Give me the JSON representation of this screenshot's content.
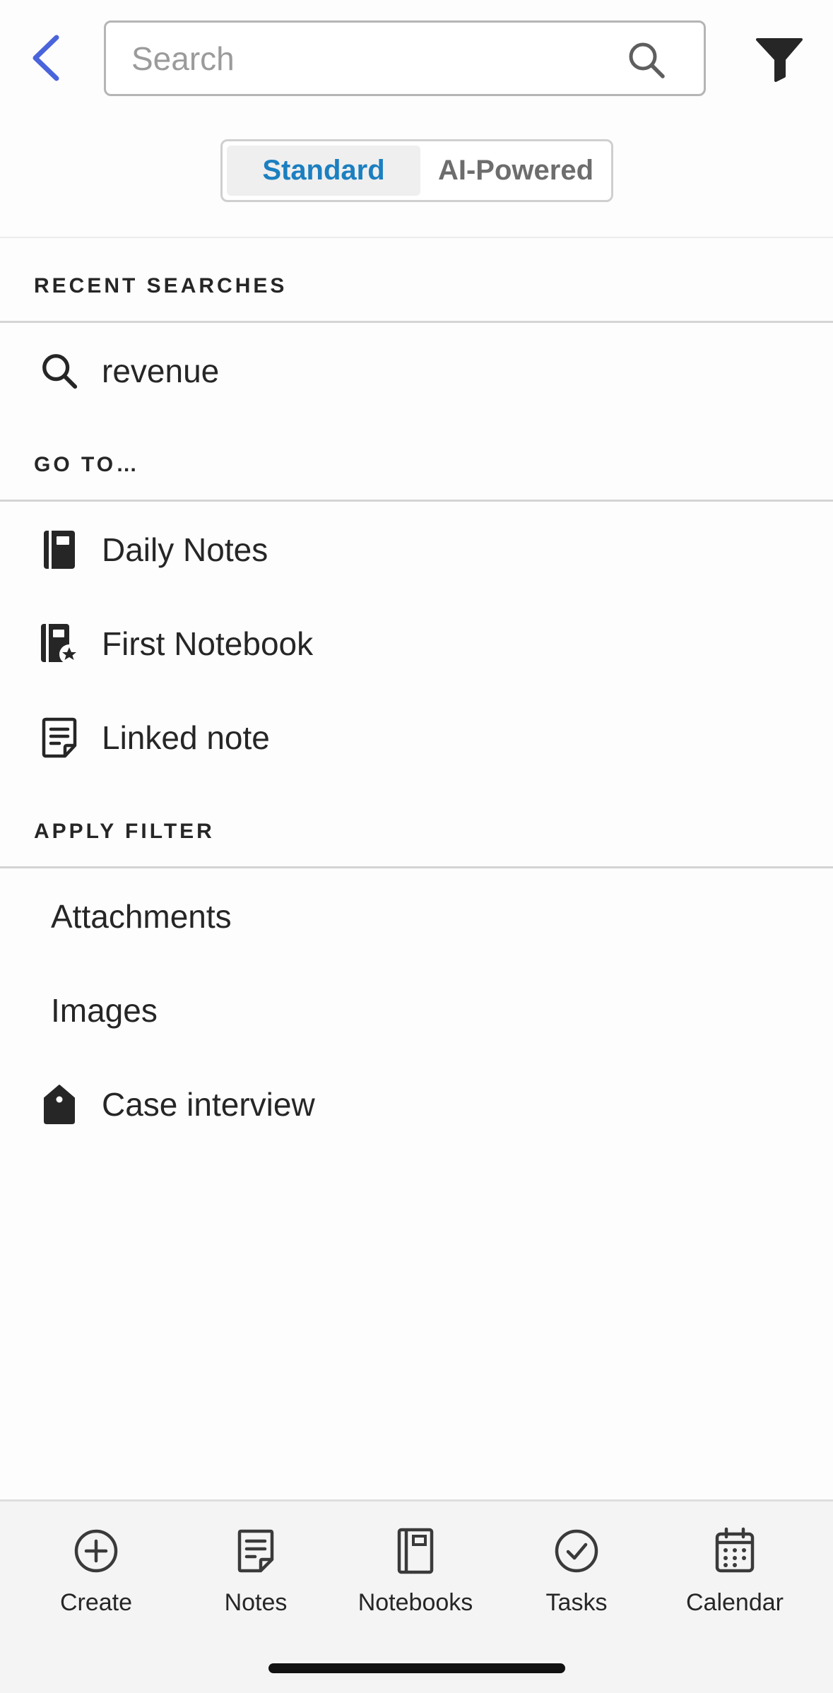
{
  "header": {
    "search_placeholder": "Search",
    "back_icon": "chevron-left-icon",
    "filter_icon": "funnel-icon"
  },
  "segment": {
    "tabs": [
      {
        "label": "Standard",
        "active": true
      },
      {
        "label": "AI-Powered",
        "active": false
      }
    ]
  },
  "recent": {
    "title": "RECENT SEARCHES",
    "items": [
      {
        "label": "revenue",
        "icon": "search-icon"
      }
    ]
  },
  "goto": {
    "title": "GO TO…",
    "items": [
      {
        "label": "Daily Notes",
        "icon": "notebook-icon"
      },
      {
        "label": "First Notebook",
        "icon": "notebook-star-icon"
      },
      {
        "label": "Linked note",
        "icon": "note-icon"
      }
    ]
  },
  "filters": {
    "title": "APPLY FILTER",
    "items": [
      {
        "label": "Attachments"
      },
      {
        "label": "Images"
      },
      {
        "label": "Case interview",
        "icon": "tag-icon"
      }
    ]
  },
  "nav": {
    "items": [
      {
        "label": "Create",
        "icon": "plus-circle-icon"
      },
      {
        "label": "Notes",
        "icon": "note-icon"
      },
      {
        "label": "Notebooks",
        "icon": "notebook-icon"
      },
      {
        "label": "Tasks",
        "icon": "check-circle-icon"
      },
      {
        "label": "Calendar",
        "icon": "calendar-icon"
      }
    ]
  },
  "colors": {
    "accent_blue": "#1b7fc0",
    "back_blue": "#4a64dc",
    "text": "#262626"
  }
}
